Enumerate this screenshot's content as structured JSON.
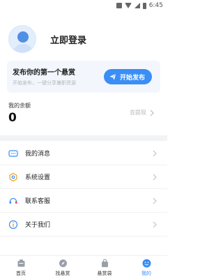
{
  "status_bar": {
    "time": "6:45"
  },
  "profile": {
    "login_label": "立即登录"
  },
  "bounty_card": {
    "title": "发布你的第一个悬赏",
    "subtitle": "开始发布，一键分享兼职资源",
    "button_label": "开始发布"
  },
  "balance": {
    "label": "我的余额",
    "value": "0",
    "withdraw_label": "去提现"
  },
  "menu": {
    "items": [
      {
        "label": "我的消息",
        "icon": "message-icon"
      },
      {
        "label": "系统设置",
        "icon": "settings-icon"
      },
      {
        "label": "联系客服",
        "icon": "customer-service-icon"
      },
      {
        "label": "关于我们",
        "icon": "info-icon"
      }
    ]
  },
  "tabs": [
    {
      "label": "首页",
      "icon": "home-icon"
    },
    {
      "label": "找悬赏",
      "icon": "compass-icon"
    },
    {
      "label": "悬赏袋",
      "icon": "bag-icon"
    },
    {
      "label": "我的",
      "icon": "smiley-icon",
      "active": true
    }
  ],
  "colors": {
    "accent": "#3a8ef6",
    "card_background": "#f3f7fd",
    "divider": "#f2f3f5",
    "muted_text": "#b5b5b5"
  }
}
